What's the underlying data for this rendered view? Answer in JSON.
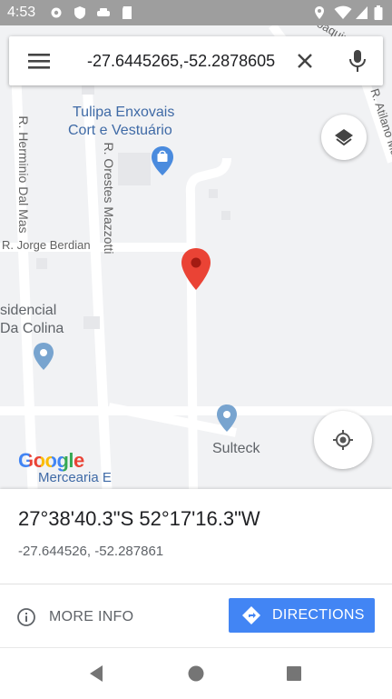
{
  "status_bar": {
    "time": "4:53"
  },
  "search": {
    "query": "-27.6445265,-52.2878605"
  },
  "map": {
    "streets": {
      "herminio": "R. Herminio Dal Mas",
      "orestes": "R. Orestes Mazzotti",
      "jorge": "R. Jorge Berdian",
      "atilano": "R. Atilano Machado",
      "joaquim": "R. Joaquim"
    },
    "places": {
      "tulipa_line1": "Tulipa Enxovais",
      "tulipa_line2": "Cort e Vestuário",
      "residencial_line1": "sidencial",
      "residencial_line2": "Da Colina",
      "sulteck": "Sulteck",
      "mercearia": "Mercearia E"
    },
    "logo": "Google"
  },
  "sheet": {
    "coordinates_dms": "27°38'40.3\"S 52°17'16.3\"W",
    "coordinates_decimal": "-27.644526, -52.287861",
    "more_info_label": "MORE INFO",
    "directions_label": "DIRECTIONS"
  },
  "colors": {
    "accent": "#4285f4",
    "pin": "#ea4335",
    "map_background": "#f1f2f4",
    "poi_text": "#3f6aa6"
  }
}
